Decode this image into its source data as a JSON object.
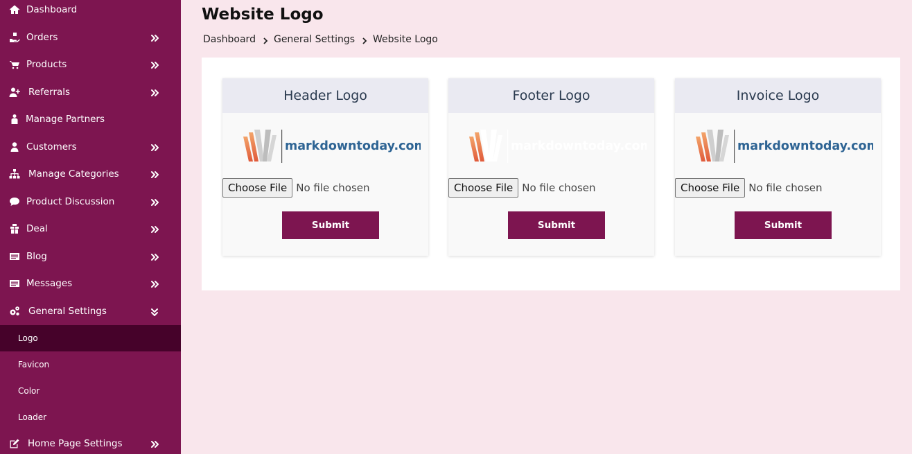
{
  "sidebar": {
    "items": [
      {
        "label": "Dashboard",
        "icon": "home-icon",
        "expandable": false
      },
      {
        "label": "Orders",
        "icon": "hand-box-icon",
        "expandable": true
      },
      {
        "label": "Products",
        "icon": "cart-icon",
        "expandable": true
      },
      {
        "label": "Referrals",
        "icon": "user-plus-icon",
        "expandable": true
      },
      {
        "label": "Manage Partners",
        "icon": "people-icon",
        "expandable": false
      },
      {
        "label": "Customers",
        "icon": "user-icon",
        "expandable": true
      },
      {
        "label": "Manage Categories",
        "icon": "sitemap-icon",
        "expandable": true
      },
      {
        "label": "Product Discussion",
        "icon": "comment-icon",
        "expandable": true
      },
      {
        "label": "Deal",
        "icon": "deal-icon",
        "expandable": true
      },
      {
        "label": "Blog",
        "icon": "blog-icon",
        "expandable": true
      },
      {
        "label": "Messages",
        "icon": "messages-icon",
        "expandable": true
      },
      {
        "label": "General Settings",
        "icon": "gears-icon",
        "expandable": true,
        "expanded": true
      },
      {
        "label": "Home Page Settings",
        "icon": "edit-icon",
        "expandable": true
      }
    ],
    "submenu": [
      {
        "label": "Logo",
        "active": true
      },
      {
        "label": "Favicon",
        "active": false
      },
      {
        "label": "Color",
        "active": false
      },
      {
        "label": "Loader",
        "active": false
      }
    ]
  },
  "page": {
    "title": "Website Logo",
    "breadcrumb": [
      "Dashboard",
      "General Settings",
      "Website Logo"
    ]
  },
  "cards": [
    {
      "title": "Header Logo",
      "logo_text": "markdowntoday.com",
      "logo_text_color": "#2e6494",
      "choose_label": "Choose File",
      "file_status": "No file chosen",
      "submit_label": "Submit"
    },
    {
      "title": "Footer Logo",
      "logo_text": "markdowntoday.com",
      "logo_text_color": "#ffffff",
      "choose_label": "Choose File",
      "file_status": "No file chosen",
      "submit_label": "Submit"
    },
    {
      "title": "Invoice Logo",
      "logo_text": "markdowntoday.com",
      "logo_text_color": "#2e6494",
      "choose_label": "Choose File",
      "file_status": "No file chosen",
      "submit_label": "Submit"
    }
  ],
  "colors": {
    "sidebar_bg": "#7d1550",
    "sidebar_active": "#46022a",
    "page_bg": "#f9e6ec",
    "accent": "#7d1550"
  }
}
